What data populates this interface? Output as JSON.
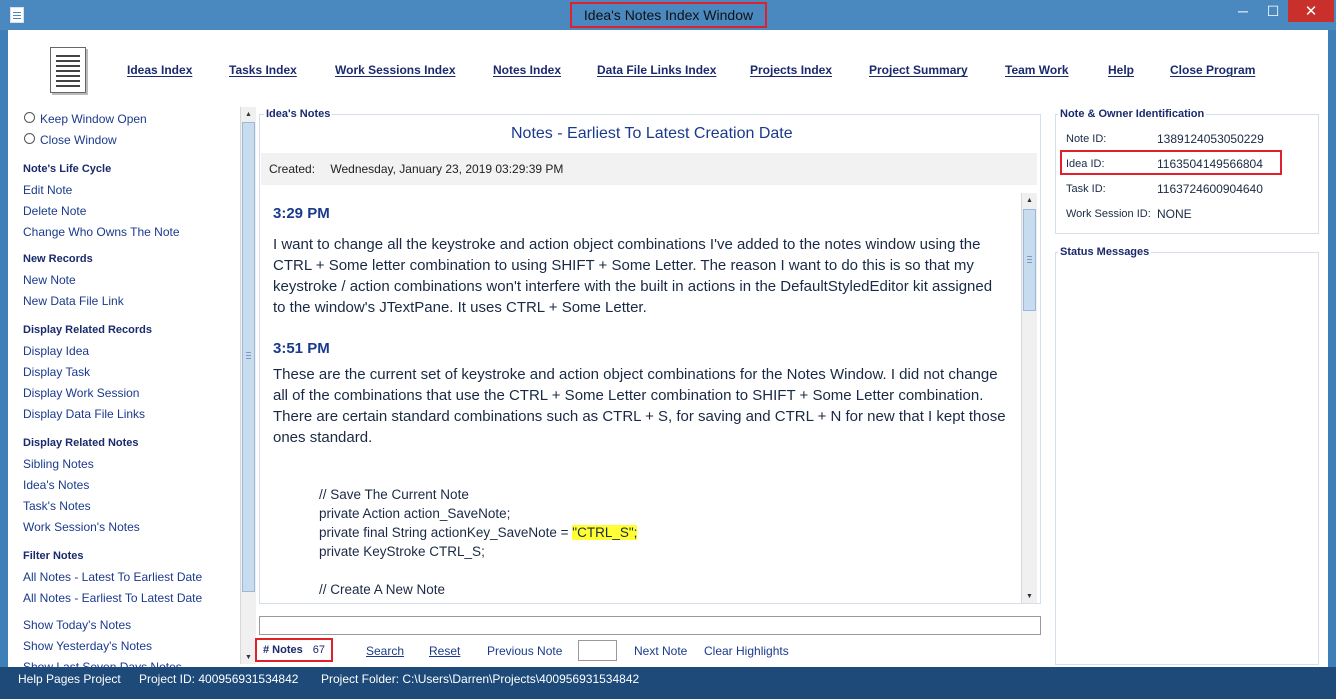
{
  "window": {
    "title": "Idea's Notes Index Window",
    "min": "─",
    "max": "☐",
    "close": "✕"
  },
  "menu": [
    {
      "label": "Ideas Index",
      "name": "menu-ideas-index"
    },
    {
      "label": "Tasks Index",
      "name": "menu-tasks-index"
    },
    {
      "label": "Work Sessions Index",
      "name": "menu-work-sessions-index"
    },
    {
      "label": "Notes Index",
      "name": "menu-notes-index"
    },
    {
      "label": "Data File Links Index",
      "name": "menu-data-file-links-index"
    },
    {
      "label": "Projects Index",
      "name": "menu-projects-index"
    },
    {
      "label": "Project Summary",
      "name": "menu-project-summary"
    },
    {
      "label": "Team Work",
      "name": "menu-team-work"
    },
    {
      "label": "Help",
      "name": "menu-help"
    },
    {
      "label": "Close Program",
      "name": "menu-close-program"
    }
  ],
  "sidebar": {
    "keep_open": "Keep Window Open",
    "close_window": "Close Window",
    "life_cycle": {
      "heading": "Note's Life Cycle",
      "items": [
        "Edit Note",
        "Delete Note",
        "Change Who Owns The Note"
      ]
    },
    "new_records": {
      "heading": "New Records",
      "items": [
        "New Note",
        "New Data File Link"
      ]
    },
    "related_records": {
      "heading": "Display Related Records",
      "items": [
        "Display Idea",
        "Display Task",
        "Display Work Session",
        "Display Data File Links"
      ]
    },
    "related_notes": {
      "heading": "Display Related Notes",
      "items": [
        "Sibling Notes",
        "Idea's Notes",
        "Task's Notes",
        "Work Session's Notes"
      ]
    },
    "filter_notes": {
      "heading": "Filter Notes",
      "items": [
        "All Notes - Latest To Earliest Date",
        "All Notes - Earliest To Latest Date",
        "Show Today's Notes",
        "Show Yesterday's Notes",
        "Show Last Seven Days Notes"
      ]
    }
  },
  "notes_panel": {
    "group_title": "Idea's Notes",
    "heading": "Notes - Earliest To Latest Creation Date",
    "created_label": "Created:",
    "created_value": "Wednesday, January 23, 2019   03:29:39 PM"
  },
  "note_content": {
    "entry1_time": "3:29 PM",
    "entry1_text": "I want to change all the keystroke and action object combinations I've added to the notes window using the CTRL + Some letter combination to using SHIFT + Some Letter. The reason I want to do this is so that my keystroke / action combinations won't interfere with the built in actions in the DefaultStyledEditor kit assigned to the window's JTextPane. It uses CTRL + Some Letter.",
    "entry2_time": "3:51 PM",
    "entry2_text": "These are the current set of keystroke and action object combinations for the Notes Window. I did not change all of the combinations that use the CTRL + Some Letter combination to SHIFT + Some Letter combination. There are certain standard combinations such as CTRL + S, for saving and CTRL + N for new that I kept those ones standard.",
    "code1": "// Save The Current Note",
    "code2": "private Action action_SaveNote;",
    "code3_prefix": "private final String actionKey_SaveNote = ",
    "code3_hl": "\"CTRL_S\";",
    "code4": "private KeyStroke CTRL_S;",
    "code5": "// Create A New Note"
  },
  "bottom_bar": {
    "notes_label": "# Notes",
    "notes_count": "67",
    "search": "Search",
    "reset": "Reset",
    "previous": "Previous Note",
    "next": "Next Note",
    "clear": "Clear Highlights"
  },
  "identification": {
    "title": "Note & Owner Identification",
    "note_id_label": "Note ID:",
    "note_id": "1389124053050229",
    "idea_id_label": "Idea ID:",
    "idea_id": "1163504149566804",
    "task_id_label": "Task ID:",
    "task_id": "1163724600904640",
    "ws_id_label": "Work Session ID:",
    "ws_id": "NONE"
  },
  "status_messages": {
    "title": "Status Messages"
  },
  "statusbar": {
    "project": "Help Pages Project",
    "project_id": "Project ID:  400956931534842",
    "project_folder": "Project Folder:  C:\\Users\\Darren\\Projects\\400956931534842"
  }
}
